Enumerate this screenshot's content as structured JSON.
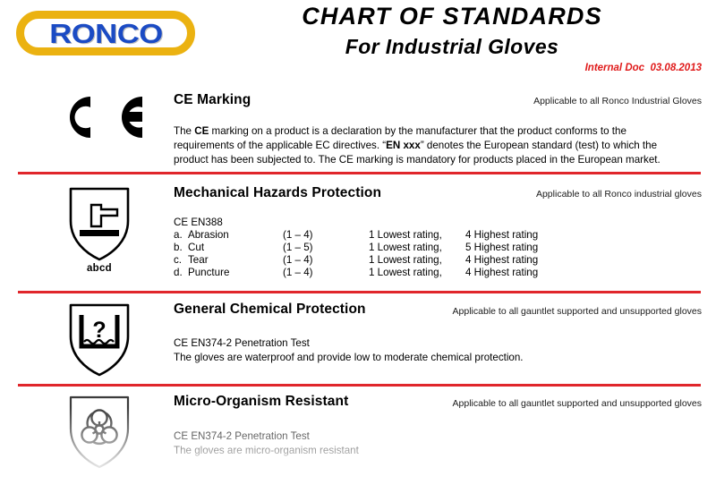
{
  "document": {
    "title_line1": "CHART  OF  STANDARDS",
    "title_line2": "For Industrial Gloves",
    "internal_doc": "Internal Doc  03.08.2013",
    "logo_text": "RONCO",
    "brand_colors": {
      "logo_outline": "#EBB211",
      "logo_text": "#1B4BC4",
      "rule": "#E0262B",
      "stamp": "#E01B1B"
    }
  },
  "sections": [
    {
      "id": "ce-marking",
      "icon": "ce-mark-icon",
      "icon_label": "",
      "title": "CE  Marking",
      "applicability": "Applicable to all Ronco Industrial Gloves",
      "paragraph": {
        "part1": "The ",
        "bold1": "CE",
        "part2": " marking on a product is a declaration by the manufacturer that the product conforms to the requirements of the applicable EC directives.  “",
        "bold2": "EN xxx",
        "part3": "” denotes the European standard (test) to which the product has been subjected to. The CE marking is mandatory for products placed in the European market."
      }
    },
    {
      "id": "mechanical-hazards",
      "icon": "shield-hammer-icon",
      "icon_label": "abcd",
      "title": "Mechanical Hazards Protection",
      "applicability": "Applicable to all Ronco industrial gloves",
      "standard": "CE EN388",
      "ratings_rows": [
        {
          "index": "a.",
          "name": "Abrasion",
          "range": "(1 – 4)",
          "low": "1  Lowest rating,",
          "high": "4  Highest rating"
        },
        {
          "index": "b.",
          "name": "Cut",
          "range": "(1 – 5)",
          "low": "1  Lowest rating,",
          "high": "5  Highest rating"
        },
        {
          "index": "c.",
          "name": "Tear",
          "range": "(1 – 4)",
          "low": "1  Lowest rating,",
          "high": "4  Highest rating"
        },
        {
          "index": "d.",
          "name": "Puncture",
          "range": "(1 – 4)",
          "low": "1  Lowest rating,",
          "high": "4  Highest rating"
        }
      ]
    },
    {
      "id": "general-chemical",
      "icon": "shield-beaker-question-icon",
      "icon_label": "",
      "title": "General Chemical Protection",
      "applicability": "Applicable to all gauntlet supported and unsupported gloves",
      "standard": "CE EN374-2   Penetration Test",
      "description": "The gloves are waterproof and provide low to moderate chemical protection."
    },
    {
      "id": "micro-organism",
      "icon": "shield-biohazard-icon",
      "icon_label": "",
      "title": "Micro-Organism Resistant",
      "applicability": "Applicable to all gauntlet supported and unsupported gloves",
      "standard": "CE EN374-2  Penetration Test",
      "description": "The gloves are micro-organism resistant"
    }
  ]
}
